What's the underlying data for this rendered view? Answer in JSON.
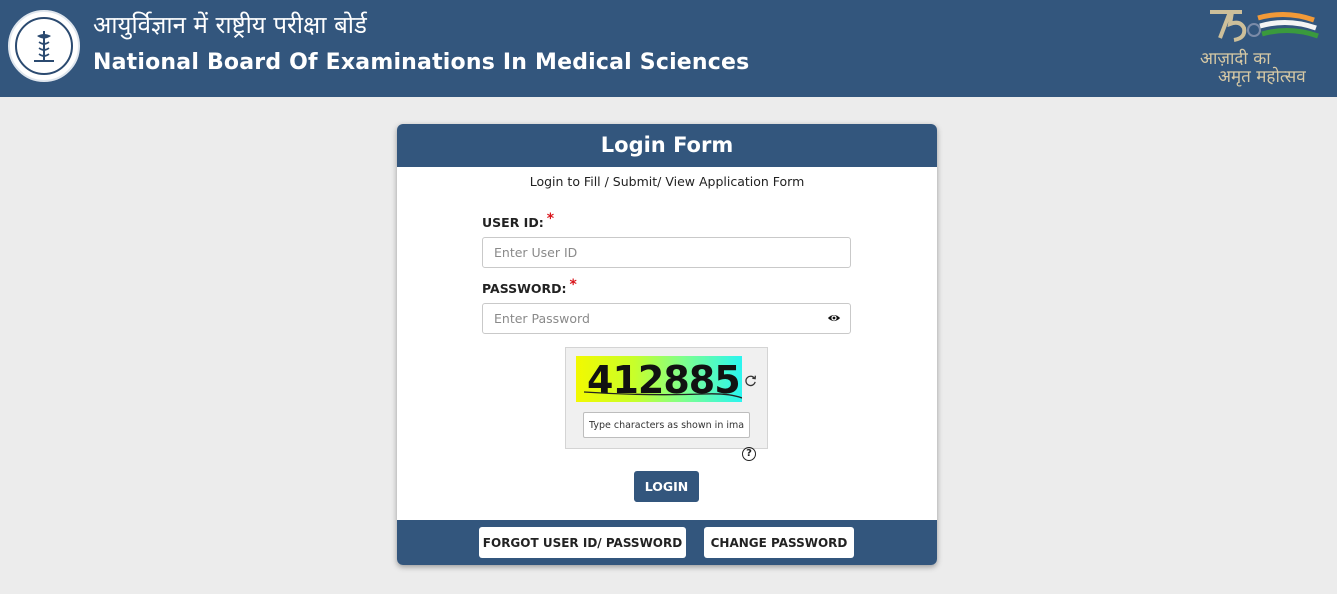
{
  "header": {
    "title_hindi": "आयुर्विज्ञान में राष्ट्रीय परीक्षा बोर्ड",
    "title_english": "National Board Of Examinations In Medical Sciences",
    "emblem_right": {
      "line1": "आज़ादी का",
      "line2": "अमृत महोत्सव"
    }
  },
  "login_form": {
    "title": "Login Form",
    "subtitle": "Login to Fill / Submit/ View Application Form",
    "user_id_label": "USER ID:",
    "user_id_placeholder": "Enter User ID",
    "password_label": "PASSWORD:",
    "password_placeholder": "Enter Password",
    "required_mark": "*",
    "captcha_text": "412885",
    "captcha_placeholder": "Type characters as shown in image",
    "help_symbol": "?",
    "login_button": "LOGIN"
  },
  "footer": {
    "forgot_button": "FORGOT USER ID/ PASSWORD",
    "change_button": "CHANGE PASSWORD"
  },
  "icons": {
    "logo": "nbems-emblem-icon",
    "emblem": "azadi-ka-amrit-mahotsav-icon",
    "eye": "eye-icon",
    "refresh": "refresh-icon",
    "help": "help-icon"
  },
  "colors": {
    "brand": "#33567d",
    "background": "#ececec",
    "required": "#d9141a"
  }
}
